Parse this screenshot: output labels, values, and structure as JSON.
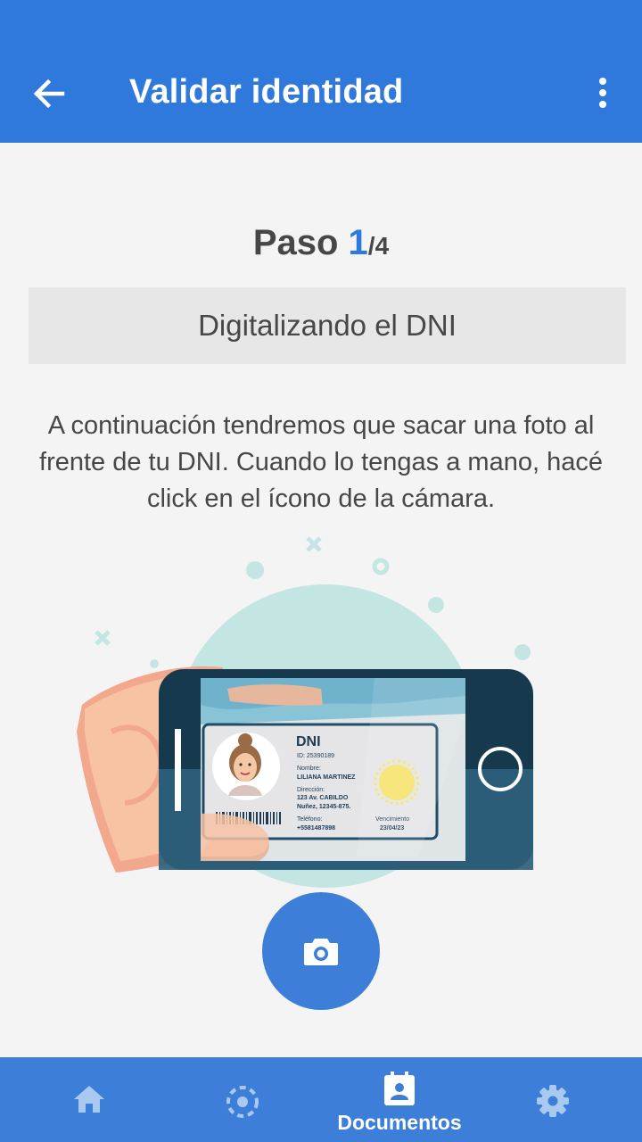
{
  "appbar": {
    "title": "Validar identidad",
    "back_icon": "arrow-back-icon",
    "menu_icon": "more-vert-icon",
    "color": "#2f78dc"
  },
  "step": {
    "prefix": "Paso ",
    "current": "1",
    "total": "/4"
  },
  "banner": {
    "text": "Digitalizando el DNI"
  },
  "description": "A continuación tendremos que sacar una foto al frente de tu DNI. Cuando lo tengas a mano, hacé click en el ícono de la cámara.",
  "id_card": {
    "title": "DNI",
    "id": "ID: 25390189",
    "name_label": "Nombre:",
    "name": "LILIANA MARTINEZ",
    "address_label": "Dirección:",
    "address_line1": "123 Av. CABILDO",
    "address_line2": "Nuñez, 12345-875.",
    "phone_label": "Teléfono:",
    "phone": "+5581487898",
    "expiry_label": "Vencimiento",
    "expiry": "23/04/23"
  },
  "camera_button": {
    "icon": "camera-icon",
    "color": "#3d7fd8"
  },
  "bottom_nav": {
    "items": [
      {
        "icon": "home-icon",
        "label": ""
      },
      {
        "icon": "scan-icon",
        "label": ""
      },
      {
        "icon": "document-id-icon",
        "label": "Documentos",
        "active": true
      },
      {
        "icon": "gear-icon",
        "label": ""
      }
    ]
  }
}
